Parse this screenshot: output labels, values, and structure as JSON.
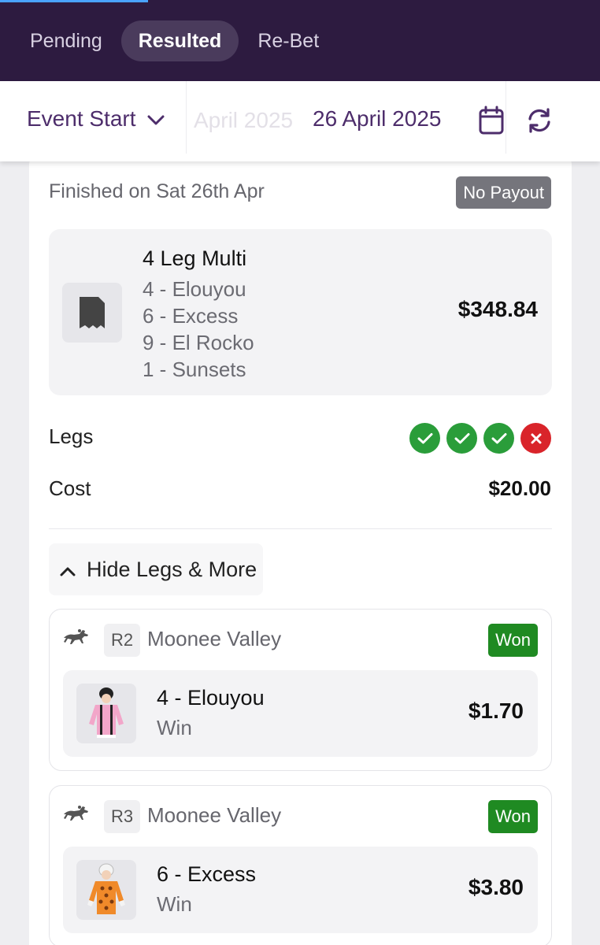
{
  "tabs": [
    {
      "label": "Pending"
    },
    {
      "label": "Resulted"
    },
    {
      "label": "Re-Bet"
    }
  ],
  "filter": {
    "sort_label": "Event Start",
    "ghost_date": "April 2025",
    "date": "26 April 2025"
  },
  "bet": {
    "finished_text": "Finished on Sat 26th Apr",
    "payout_status": "No Payout",
    "multi_title": "4 Leg Multi",
    "selections": [
      "4 - Elouyou",
      "6 - Excess",
      "9 - El Rocko",
      "1 - Sunsets"
    ],
    "potential_return": "$348.84",
    "legs_label": "Legs",
    "leg_results": [
      "won",
      "won",
      "won",
      "lost"
    ],
    "cost_label": "Cost",
    "cost_value": "$20.00",
    "toggle_label": "Hide Legs & More"
  },
  "legs": [
    {
      "race": "R2",
      "venue": "Moonee Valley",
      "status": "Won",
      "runner": "4 - Elouyou",
      "bet_type": "Win",
      "odds": "$1.70",
      "silk_colors": {
        "body": "#f2a6c9",
        "stripe": "#222222",
        "cap": "#222222"
      }
    },
    {
      "race": "R3",
      "venue": "Moonee Valley",
      "status": "Won",
      "runner": "6 - Excess",
      "bet_type": "Win",
      "odds": "$3.80",
      "silk_colors": {
        "body": "#f08a2a",
        "spots": "#7a3a10",
        "cap": "#f4f4f4"
      }
    }
  ],
  "colors": {
    "nav_bg": "#2d1b40",
    "accent_purple": "#4d2d6b",
    "won_green": "#2a9d3a",
    "lost_red": "#d9242a",
    "badge_grey": "#75757c"
  }
}
